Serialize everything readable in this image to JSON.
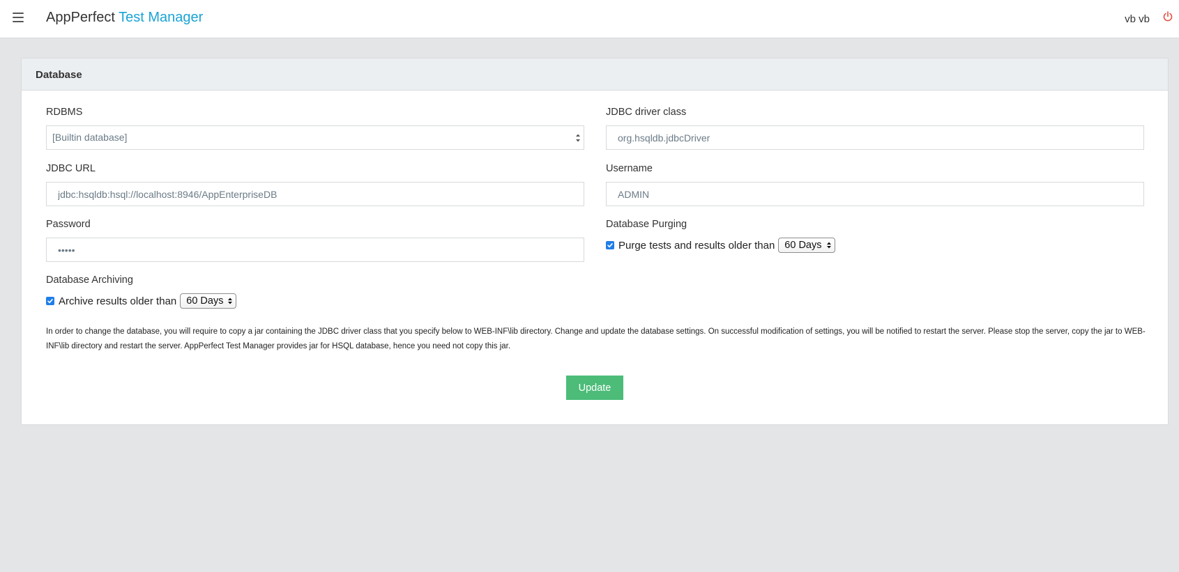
{
  "header": {
    "brand_primary": "AppPerfect",
    "brand_accent": "Test Manager",
    "user_name": "vb vb"
  },
  "icons": {
    "menu": "hamburger-menu-icon",
    "power": "power-icon",
    "checkbox": "checkmark-icon",
    "select": "up-down-arrows-icon"
  },
  "panel": {
    "title": "Database"
  },
  "form": {
    "rdbms": {
      "label": "RDBMS",
      "value": "[Builtin database]"
    },
    "jdbc_driver": {
      "label": "JDBC driver class",
      "value": "org.hsqldb.jdbcDriver"
    },
    "jdbc_url": {
      "label": "JDBC URL",
      "value": "jdbc:hsqldb:hsql://localhost:8946/AppEnterpriseDB"
    },
    "username": {
      "label": "Username",
      "value": "ADMIN"
    },
    "password": {
      "label": "Password",
      "value": "•••••"
    },
    "purging": {
      "label": "Database Purging",
      "checkbox_label": "Purge tests and results older than",
      "checked": true,
      "selected": "60 Days"
    },
    "archiving": {
      "label": "Database Archiving",
      "checkbox_label": "Archive results older than",
      "checked": true,
      "selected": "60 Days"
    }
  },
  "info_text": "In order to change the database, you will require to copy a jar containing the JDBC driver class that you specify below to WEB-INF\\lib directory. Change and update the database settings. On successful modification of settings, you will be notified to restart the server. Please stop the server, copy the jar to WEB-INF\\lib directory and restart the server. AppPerfect Test Manager provides jar for HSQL database, hence you need not copy this jar.",
  "actions": {
    "update_label": "Update"
  },
  "colors": {
    "accent": "#1aa3d6",
    "button": "#4cbc78",
    "power": "#e74c3c",
    "checkbox": "#1f7ee8"
  }
}
